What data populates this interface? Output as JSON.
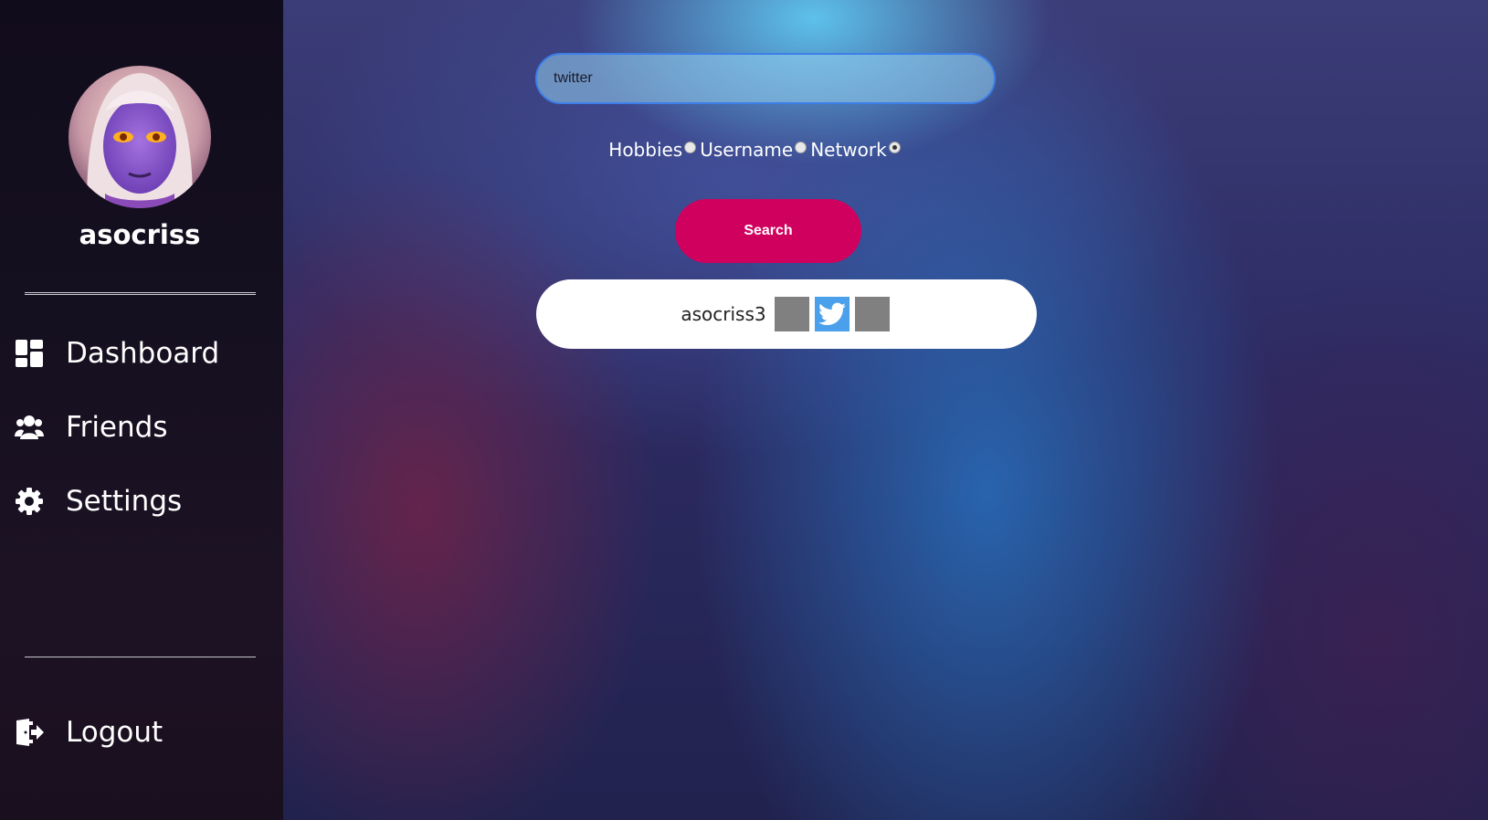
{
  "sidebar": {
    "profile": {
      "username": "asocriss"
    },
    "nav": [
      {
        "label": "Dashboard",
        "icon": "dashboard-icon"
      },
      {
        "label": "Friends",
        "icon": "users-icon"
      },
      {
        "label": "Settings",
        "icon": "gear-icon"
      }
    ],
    "logout": {
      "label": "Logout",
      "icon": "logout-icon"
    }
  },
  "search": {
    "value": "twitter",
    "button_label": "Search",
    "options": [
      {
        "label": "Hobbies",
        "checked": false
      },
      {
        "label": "Username",
        "checked": false
      },
      {
        "label": "Network",
        "checked": true
      }
    ]
  },
  "result": {
    "name": "asocriss3",
    "networks": [
      "placeholder-icon",
      "twitter-icon",
      "placeholder-icon"
    ]
  },
  "colors": {
    "accent": "#d0005f",
    "twitter": "#4aa0ea",
    "sidebar_bg": "#151020"
  }
}
